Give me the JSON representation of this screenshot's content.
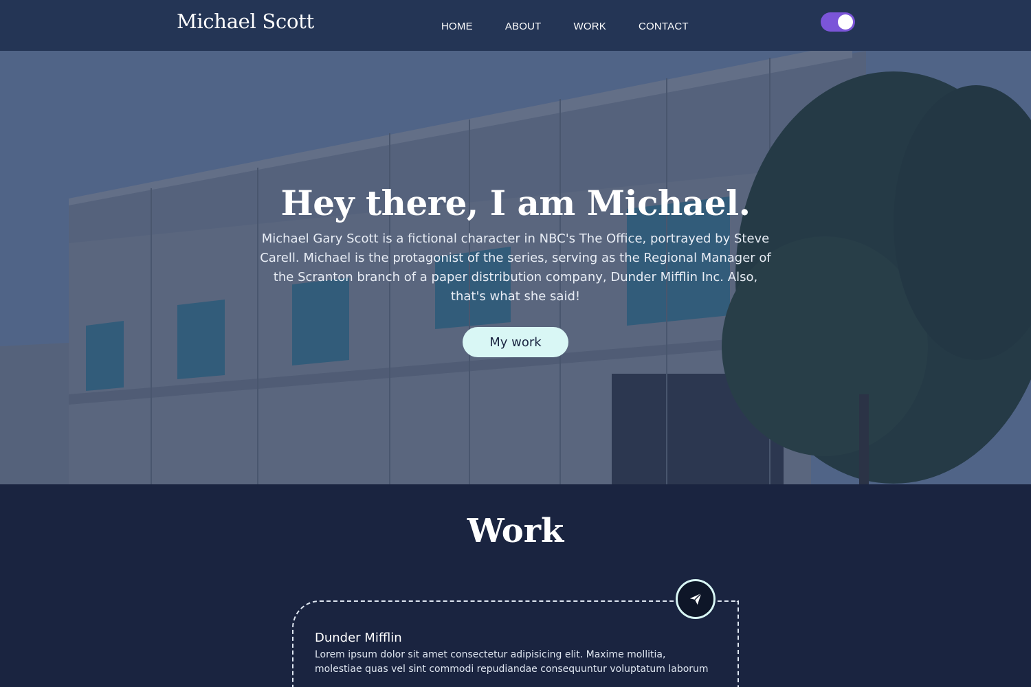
{
  "nav": {
    "brand": "Michael Scott",
    "links": [
      "HOME",
      "ABOUT",
      "WORK",
      "CONTACT"
    ],
    "theme_toggle_on": true,
    "toggle_color": "#7b55d8"
  },
  "hero": {
    "title": "Hey there, I am Michael.",
    "description": "Michael Gary Scott is a fictional character in NBC's The Office, portrayed by Steve Carell. Michael is the protagonist of the series, serving as the Regional Manager of the Scranton branch of a paper distribution company, Dunder Mifflin Inc. Also, that's what she said!",
    "button_label": "My work",
    "button_color": "#d9f7f5"
  },
  "work": {
    "title": "Work",
    "cards": [
      {
        "icon": "paper-plane-icon",
        "title": "Dunder Mifflin",
        "text": "Lorem ipsum dolor sit amet consectetur adipisicing elit. Maxime mollitia, molestiae quas vel sint commodi repudiandae consequuntur voluptatum laborum"
      }
    ]
  },
  "colors": {
    "page_bg": "#1a2440",
    "nav_bg": "#243555"
  }
}
